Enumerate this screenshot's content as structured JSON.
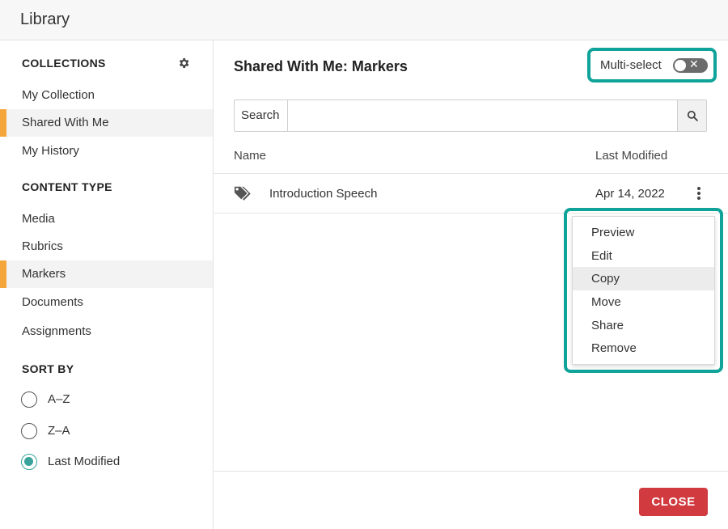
{
  "window": {
    "title": "Library"
  },
  "sidebar": {
    "collections_heading": "COLLECTIONS",
    "collections": [
      {
        "label": "My Collection",
        "active": false
      },
      {
        "label": "Shared With Me",
        "active": true
      },
      {
        "label": "My History",
        "active": false
      }
    ],
    "content_type_heading": "CONTENT TYPE",
    "content_types": [
      {
        "label": "Media",
        "active": false
      },
      {
        "label": "Rubrics",
        "active": false
      },
      {
        "label": "Markers",
        "active": true
      },
      {
        "label": "Documents",
        "active": false
      },
      {
        "label": "Assignments",
        "active": false
      }
    ],
    "sort_heading": "SORT BY",
    "sort_options": [
      {
        "label": "A–Z",
        "checked": false
      },
      {
        "label": "Z–A",
        "checked": false
      },
      {
        "label": "Last Modified",
        "checked": true
      }
    ]
  },
  "main": {
    "title": "Shared With Me: Markers",
    "multiselect_label": "Multi-select",
    "multiselect_on": false,
    "toggle_off_glyph": "✕",
    "search": {
      "label": "Search",
      "value": "",
      "placeholder": ""
    },
    "columns": {
      "name": "Name",
      "modified": "Last Modified"
    },
    "rows": [
      {
        "name": "Introduction Speech",
        "modified": "Apr 14, 2022"
      }
    ],
    "context_menu": [
      "Preview",
      "Edit",
      "Copy",
      "Move",
      "Share",
      "Remove"
    ],
    "context_menu_hover": "Copy",
    "close_label": "CLOSE"
  },
  "colors": {
    "accent_orange": "#f5a63a",
    "highlight_teal": "#0fa39a",
    "radio_teal": "#3aa39b",
    "close_red": "#d13a3f"
  },
  "icons": [
    "gear-icon",
    "search-icon",
    "tag-icon",
    "kebab-menu-icon"
  ]
}
